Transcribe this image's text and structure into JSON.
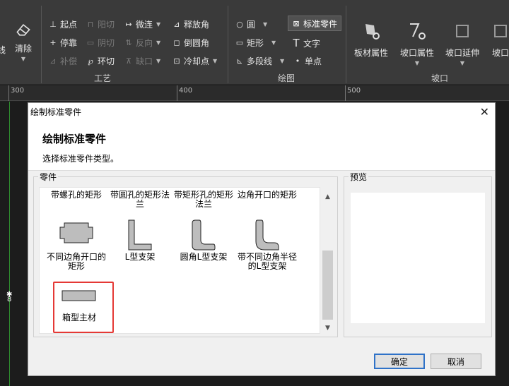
{
  "ribbon": {
    "left_partial": {
      "clear": "清除",
      "partial_label": "线"
    },
    "gongyi": {
      "label": "工艺",
      "qidian": "起点",
      "yangqie": "阳切",
      "weilian": "微连",
      "shifangjiao": "释放角",
      "tingfang": "停靠",
      "yinqie": "阴切",
      "fanxiang": "反向",
      "daoyuanjiao": "倒圆角",
      "buchang": "补偿",
      "huanqie": "环切",
      "quekou": "缺口",
      "lengquedian": "冷却点"
    },
    "huitu": {
      "label": "绘图",
      "yuan": "圆",
      "biaozhun": "标准零件",
      "juxing": "矩形",
      "wenzi": "文字",
      "duoduanxian": "多段线",
      "dandian": "单点"
    },
    "pokou": {
      "label": "坡口",
      "bancai": "板材属性",
      "pokoushuxing": "坡口属性",
      "pokouyanshen": "坡口延伸",
      "pokou_partial": "坡口"
    }
  },
  "ruler": {
    "ticks": [
      "300",
      "400",
      "500"
    ]
  },
  "canvas": {
    "origin_label": "8"
  },
  "dialog": {
    "title": "绘制标准零件",
    "heading": "绘制标准零件",
    "subtitle": "选择标准零件类型。",
    "parts_group": "零件",
    "preview_group": "预览",
    "parts": [
      {
        "label": "带螺孔的矩形"
      },
      {
        "label": "带圆孔的矩形法兰"
      },
      {
        "label": "带矩形孔的矩形法兰"
      },
      {
        "label": "边角开口的矩形"
      },
      {
        "label": "不同边角开口的矩形"
      },
      {
        "label": "L型支架"
      },
      {
        "label": "圆角L型支架"
      },
      {
        "label": "带不同边角半径的L型支架"
      },
      {
        "label": "箱型主材"
      }
    ],
    "ok": "确定",
    "cancel": "取消"
  }
}
